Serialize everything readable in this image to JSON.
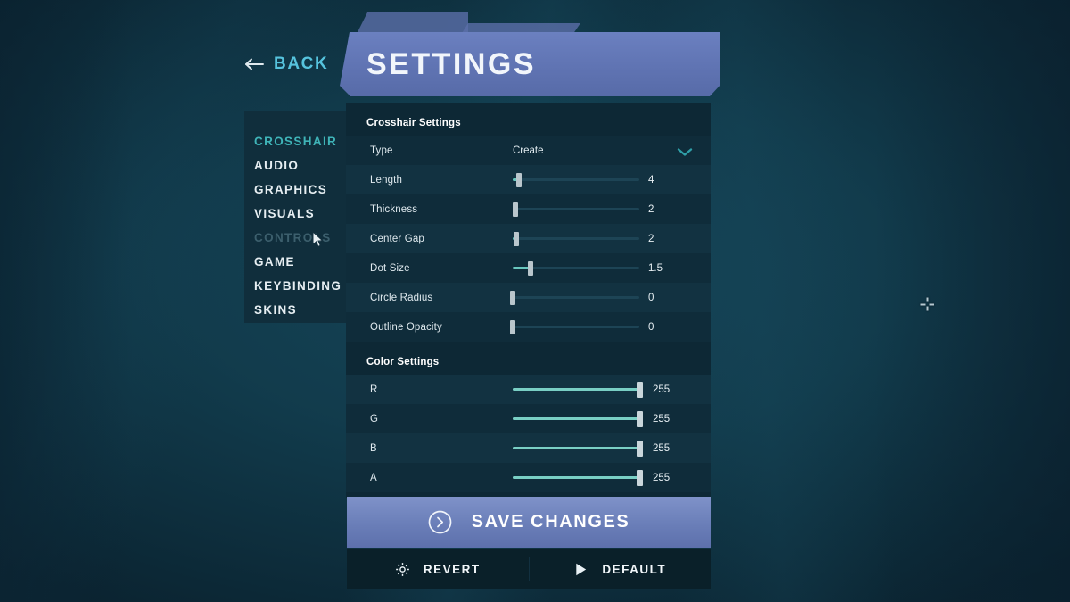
{
  "background": {
    "base_color": "#134253"
  },
  "back_button": {
    "label": "BACK",
    "icon": "arrow-left-icon",
    "color": "#56c3dd"
  },
  "header": {
    "title": "SETTINGS",
    "color": "#6276b5"
  },
  "sidebar": {
    "items": [
      {
        "label": "CROSSHAIR",
        "state": "active"
      },
      {
        "label": "AUDIO",
        "state": "normal"
      },
      {
        "label": "GRAPHICS",
        "state": "normal"
      },
      {
        "label": "VISUALS",
        "state": "normal"
      },
      {
        "label": "CONTROLS",
        "state": "dim"
      },
      {
        "label": "GAME",
        "state": "normal"
      },
      {
        "label": "KEYBINDING",
        "state": "normal"
      },
      {
        "label": "SKINS",
        "state": "normal"
      }
    ],
    "active_color": "#3fb4b8",
    "dim_color": "#3c5f6d"
  },
  "crosshair_section": {
    "title": "Crosshair Settings",
    "type_row": {
      "label": "Type",
      "value": "Create",
      "chevron": "chevron-down-icon"
    },
    "sliders": [
      {
        "label": "Length",
        "value": "4",
        "percent": 5
      },
      {
        "label": "Thickness",
        "value": "2",
        "percent": 2
      },
      {
        "label": "Center Gap",
        "value": "2",
        "percent": 3
      },
      {
        "label": "Dot Size",
        "value": "1.5",
        "percent": 14
      },
      {
        "label": "Circle Radius",
        "value": "0",
        "percent": 0
      },
      {
        "label": "Outline Opacity",
        "value": "0",
        "percent": 0
      }
    ]
  },
  "color_section": {
    "title": "Color Settings",
    "sliders": [
      {
        "label": "R",
        "value": "255",
        "percent": 100
      },
      {
        "label": "G",
        "value": "255",
        "percent": 100
      },
      {
        "label": "B",
        "value": "255",
        "percent": 100
      },
      {
        "label": "A",
        "value": "255",
        "percent": 100
      }
    ],
    "accent_color": "#79cfc4"
  },
  "save_button": {
    "label": "SAVE CHANGES",
    "icon": "arrow-right-circle-icon"
  },
  "footer": {
    "revert": {
      "label": "REVERT",
      "icon": "gear-icon"
    },
    "default": {
      "label": "DEFAULT",
      "icon": "play-icon"
    }
  },
  "preview": {
    "crosshair_icon": "crosshair-icon"
  }
}
